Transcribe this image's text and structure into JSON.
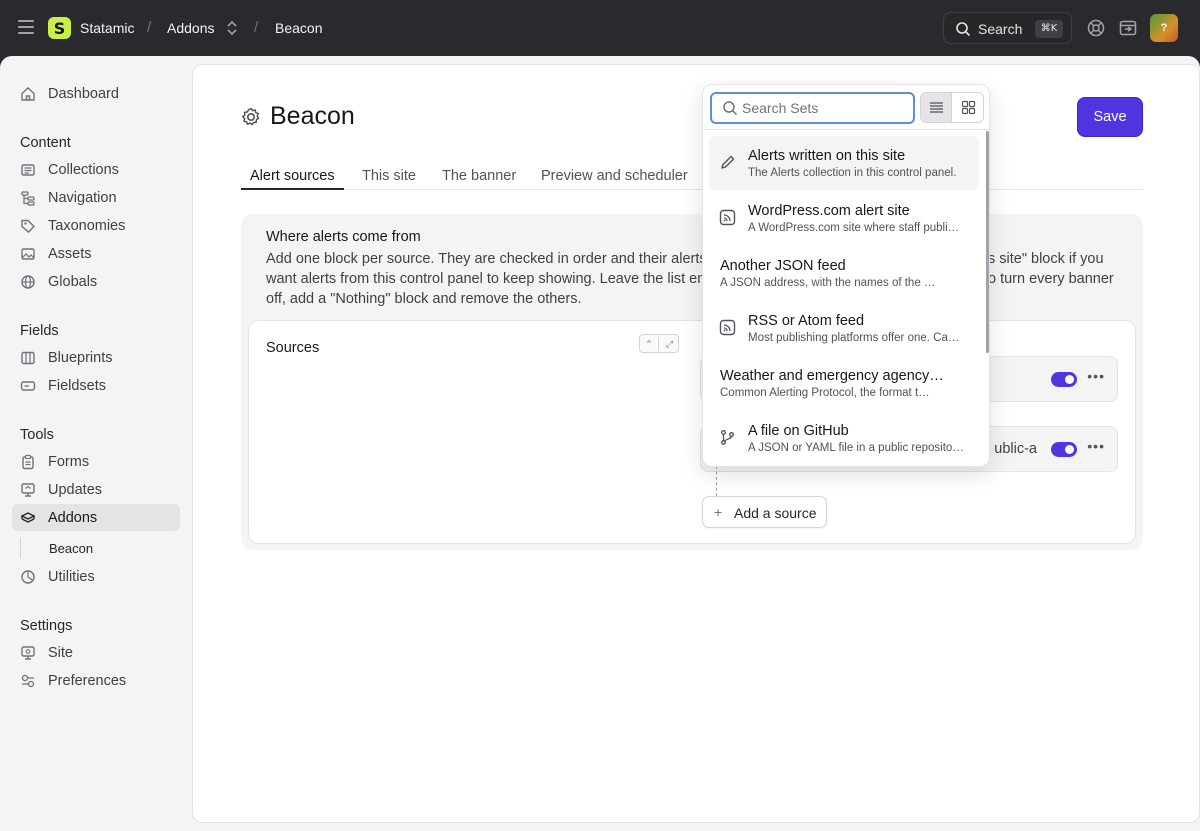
{
  "topbar": {
    "brand": "Statamic",
    "breadcrumbs": [
      "Addons",
      "Beacon"
    ],
    "separator": "/",
    "search_label": "Search",
    "search_shortcut": "⌘K",
    "avatar_initial": "?"
  },
  "sidebar": {
    "top_items": [
      {
        "label": "Dashboard",
        "icon": "house-icon"
      }
    ],
    "sections": [
      {
        "heading": "Content",
        "items": [
          {
            "label": "Collections",
            "icon": "collections-icon"
          },
          {
            "label": "Navigation",
            "icon": "navigation-icon"
          },
          {
            "label": "Taxonomies",
            "icon": "tag-icon"
          },
          {
            "label": "Assets",
            "icon": "assets-icon"
          },
          {
            "label": "Globals",
            "icon": "globe-icon"
          }
        ]
      },
      {
        "heading": "Fields",
        "items": [
          {
            "label": "Blueprints",
            "icon": "blueprint-icon"
          },
          {
            "label": "Fieldsets",
            "icon": "fieldset-icon"
          }
        ]
      },
      {
        "heading": "Tools",
        "items": [
          {
            "label": "Forms",
            "icon": "clipboard-icon"
          },
          {
            "label": "Updates",
            "icon": "updates-icon"
          },
          {
            "label": "Addons",
            "icon": "addons-icon",
            "active": true
          },
          {
            "label": "Beacon",
            "sub": true
          },
          {
            "label": "Utilities",
            "icon": "utilities-icon"
          }
        ]
      },
      {
        "heading": "Settings",
        "items": [
          {
            "label": "Site",
            "icon": "site-icon"
          },
          {
            "label": "Preferences",
            "icon": "preferences-icon"
          }
        ]
      }
    ]
  },
  "page": {
    "title": "Beacon",
    "save_label": "Save",
    "tabs": [
      "Alert sources",
      "This site",
      "The banner",
      "Preview and scheduler"
    ],
    "active_tab": "Alert sources",
    "section_title": "Where alerts come from",
    "section_text": "Add one block per source. They are checked in order and their alerts",
    "section_text_right": "s site\" block if you",
    "section_text_line2": "want alerts from this control panel to keep showing. Leave the list em",
    "section_text_line2_right": "o turn every banner",
    "section_text_line3": "off, add a \"Nothing\" block and remove the others.",
    "sources_label": "Sources",
    "block2_peek": "ublic-a",
    "add_source_label": "Add a source"
  },
  "dropdown": {
    "search_placeholder": "Search Sets",
    "search_value": "",
    "items": [
      {
        "name": "Alerts written on this site",
        "desc": "The Alerts collection in this control panel.",
        "icon": "pencil-icon",
        "highlighted": true
      },
      {
        "name": "WordPress.com alert site",
        "desc": "A WordPress.com site where staff publi…",
        "icon": "rss-icon"
      },
      {
        "name": "Another JSON feed",
        "desc": "A JSON address, with the names of the …",
        "icon": ""
      },
      {
        "name": "RSS or Atom feed",
        "desc": "Most publishing platforms offer one. Ca…",
        "icon": "rss-icon"
      },
      {
        "name": "Weather and emergency agency…",
        "desc": "Common Alerting Protocol, the format t…",
        "icon": ""
      },
      {
        "name": "A file on GitHub",
        "desc": "A JSON or YAML file in a public reposito…",
        "icon": "git-branch-icon"
      }
    ]
  },
  "colors": {
    "accent": "#4f36e0",
    "logo": "#c9f048",
    "topbar": "#2a2a2e"
  }
}
